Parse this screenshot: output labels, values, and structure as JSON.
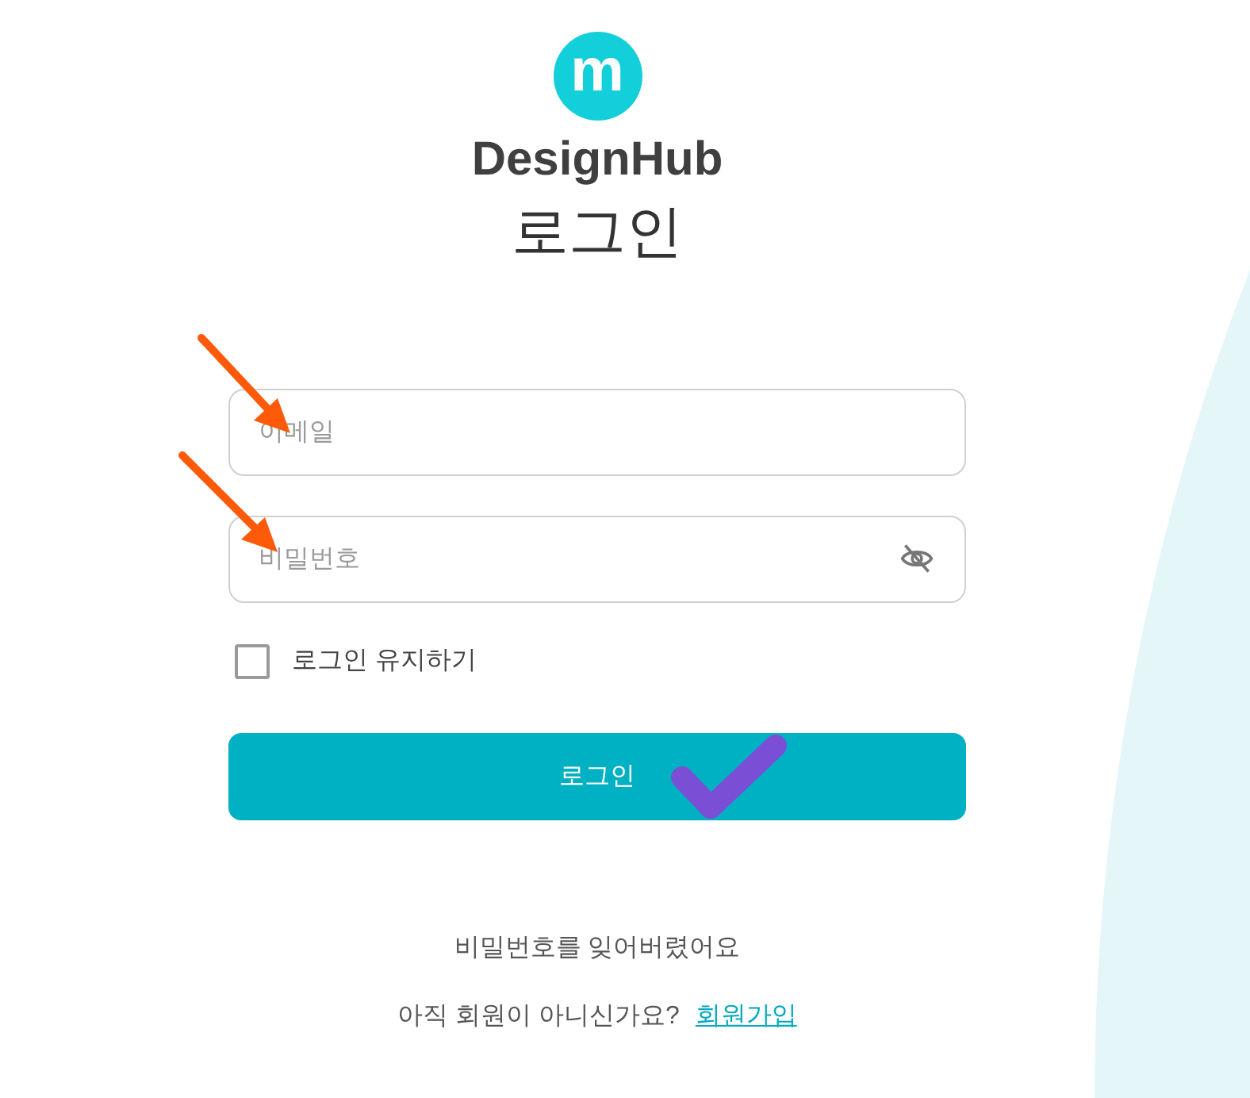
{
  "logo": {
    "mark": "m",
    "name": "DesignHub"
  },
  "title": "로그인",
  "fields": [
    {
      "kind": "email",
      "placeholder": "이메일"
    },
    {
      "kind": "password",
      "placeholder": "비밀번호"
    }
  ],
  "remember": {
    "label": "로그인 유지하기",
    "checked": false
  },
  "login_button": "로그인",
  "forgot_link": "비밀번호를 잊어버렸어요",
  "signup": {
    "prompt": "아직 회원이 아니신가요?",
    "link": "회원가입"
  }
}
